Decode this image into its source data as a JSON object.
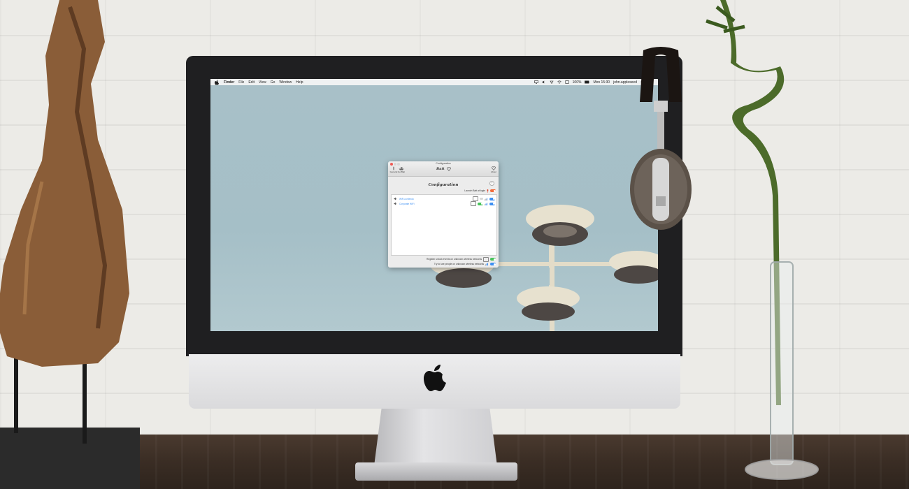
{
  "menubar": {
    "items": [
      "Finder",
      "File",
      "Edit",
      "View",
      "Go",
      "Window",
      "Help"
    ],
    "battery": "100%",
    "clock": "Mon 15:30",
    "user": "john.appleseed"
  },
  "window": {
    "title": "Configuration",
    "toolbar": {
      "general_label": "General",
      "gobait_label": "Go Bait",
      "app_name": "Bait",
      "about_label": "About"
    },
    "help": "?",
    "heading": "Configuration",
    "launch_label": "Launch Bait at login",
    "networks": [
      {
        "name": "WiFi-corriendo"
      },
      {
        "name": "Corporate WiFi"
      }
    ],
    "footer": {
      "register_label": "Register unlock events on unknown wireless networks",
      "lure_label": "Try to lure people on unknown wireless networks"
    }
  },
  "colors": {
    "accent_blue": "#3d8ff2",
    "accent_orange": "#f26b3a",
    "accent_green": "#48c35b",
    "close_red": "#ee5b55"
  }
}
